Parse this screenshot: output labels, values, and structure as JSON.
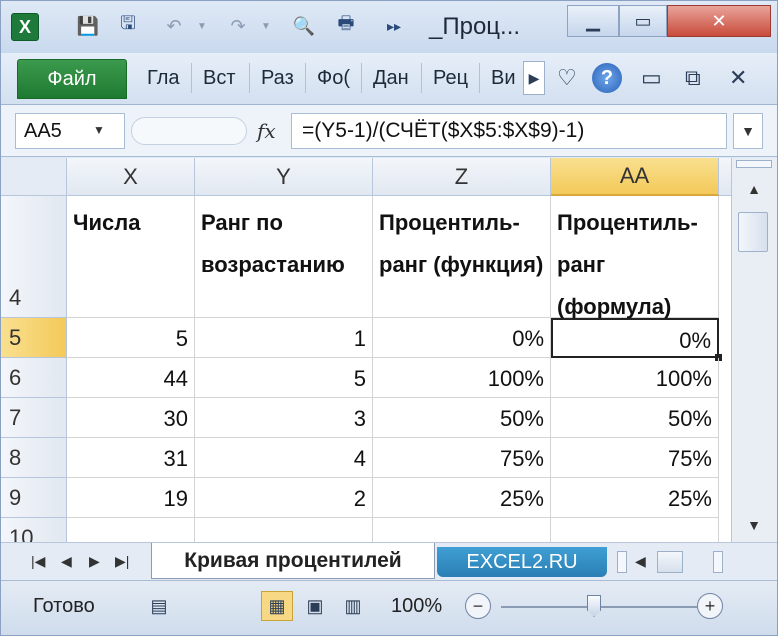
{
  "window": {
    "title": "_Проц...",
    "app_icon": "excel-icon"
  },
  "ribbon": {
    "file_label": "Файл",
    "tabs": [
      "Гла",
      "Вст",
      "Раз",
      "Фо(",
      "Дан",
      "Рец",
      "Ви"
    ]
  },
  "formula_bar": {
    "name_box": "AA5",
    "fx_label": "fx",
    "formula": "=(Y5-1)/(СЧЁТ($X$5:$X$9)-1)"
  },
  "sheet": {
    "columns": [
      "X",
      "Y",
      "Z",
      "AA"
    ],
    "selected_column": "AA",
    "header_row_number": "4",
    "headers": [
      "Числа",
      "Ранг по возрастанию",
      "Процентиль-ранг (функция)",
      "Процентиль-ранг (формула)"
    ],
    "rows": [
      {
        "row": "5",
        "x": "5",
        "y": "1",
        "z": "0%",
        "aa": "0%"
      },
      {
        "row": "6",
        "x": "44",
        "y": "5",
        "z": "100%",
        "aa": "100%"
      },
      {
        "row": "7",
        "x": "30",
        "y": "3",
        "z": "50%",
        "aa": "50%"
      },
      {
        "row": "8",
        "x": "31",
        "y": "4",
        "z": "75%",
        "aa": "75%"
      },
      {
        "row": "9",
        "x": "19",
        "y": "2",
        "z": "25%",
        "aa": "25%"
      }
    ],
    "partial_row": "10",
    "active_cell": "AA5"
  },
  "sheet_tabs": {
    "active": "Кривая процентилей",
    "other": "EXCEL2.RU"
  },
  "status": {
    "text": "Готово",
    "zoom": "100%"
  },
  "colors": {
    "selected_header": "#f3c95a",
    "file_tab": "#1f7a31",
    "close_button": "#c94b3b"
  }
}
